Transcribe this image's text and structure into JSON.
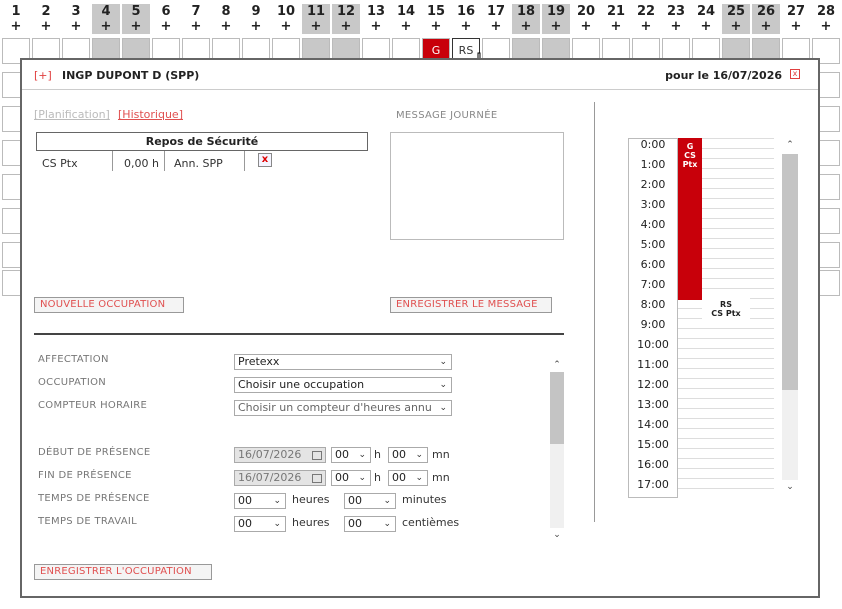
{
  "calendar": {
    "days": [
      "1",
      "2",
      "3",
      "4",
      "5",
      "6",
      "7",
      "8",
      "9",
      "10",
      "11",
      "12",
      "13",
      "14",
      "15",
      "16",
      "17",
      "18",
      "19",
      "20",
      "21",
      "22",
      "23",
      "24",
      "25",
      "26",
      "27",
      "28"
    ],
    "plus": "+",
    "cell_g": "G",
    "cell_rs": "RS"
  },
  "modal": {
    "plus": "[+]",
    "title": "INGP DUPONT D (SPP)",
    "date": "pour le 16/07/2026",
    "close": "x",
    "tab_planif": "[Planification]",
    "tab_hist": "[Historique]",
    "repos": {
      "header": "Repos de Sécurité",
      "row": {
        "code": "CS Ptx",
        "hours": "0,00 h",
        "type": "Ann. SPP",
        "delete": "x"
      }
    },
    "message_label": "MESSAGE JOURNÉE",
    "btn_new": "NOUVELLE OCCUPATION",
    "btn_save_msg": "ENREGISTRER LE MESSAGE",
    "btn_save_occ": "ENREGISTRER L'OCCUPATION",
    "form": {
      "affectation_label": "AFFECTATION",
      "affectation_value": "Pretexx",
      "occupation_label": "OCCUPATION",
      "occupation_value": "Choisir une occupation",
      "compteur_label": "COMPTEUR HORAIRE",
      "compteur_value": "Choisir un compteur d'heures annu",
      "debut_label": "DÉBUT DE PRÉSENCE",
      "debut_date": "16/07/2026",
      "debut_h": "00",
      "debut_mn": "00",
      "fin_label": "FIN DE PRÉSENCE",
      "fin_date": "16/07/2026",
      "fin_h": "00",
      "fin_mn": "00",
      "temps_pres_label": "TEMPS DE PRÉSENCE",
      "temps_pres_h": "00",
      "temps_pres_m": "00",
      "temps_trav_label": "TEMPS DE TRAVAIL",
      "temps_trav_h": "00",
      "temps_trav_c": "00",
      "unit_h": "h",
      "unit_mn": "mn",
      "unit_heures": "heures",
      "unit_minutes": "minutes",
      "unit_centiemes": "centièmes"
    },
    "timeline": {
      "hours": [
        "0:00",
        "1:00",
        "2:00",
        "3:00",
        "4:00",
        "5:00",
        "6:00",
        "7:00",
        "8:00",
        "9:00",
        "10:00",
        "11:00",
        "12:00",
        "13:00",
        "14:00",
        "15:00",
        "16:00",
        "17:00"
      ],
      "block1_line1": "G",
      "block1_line2": "CS Ptx",
      "block2_line1": "RS",
      "block2_line2": "CS Ptx"
    }
  }
}
